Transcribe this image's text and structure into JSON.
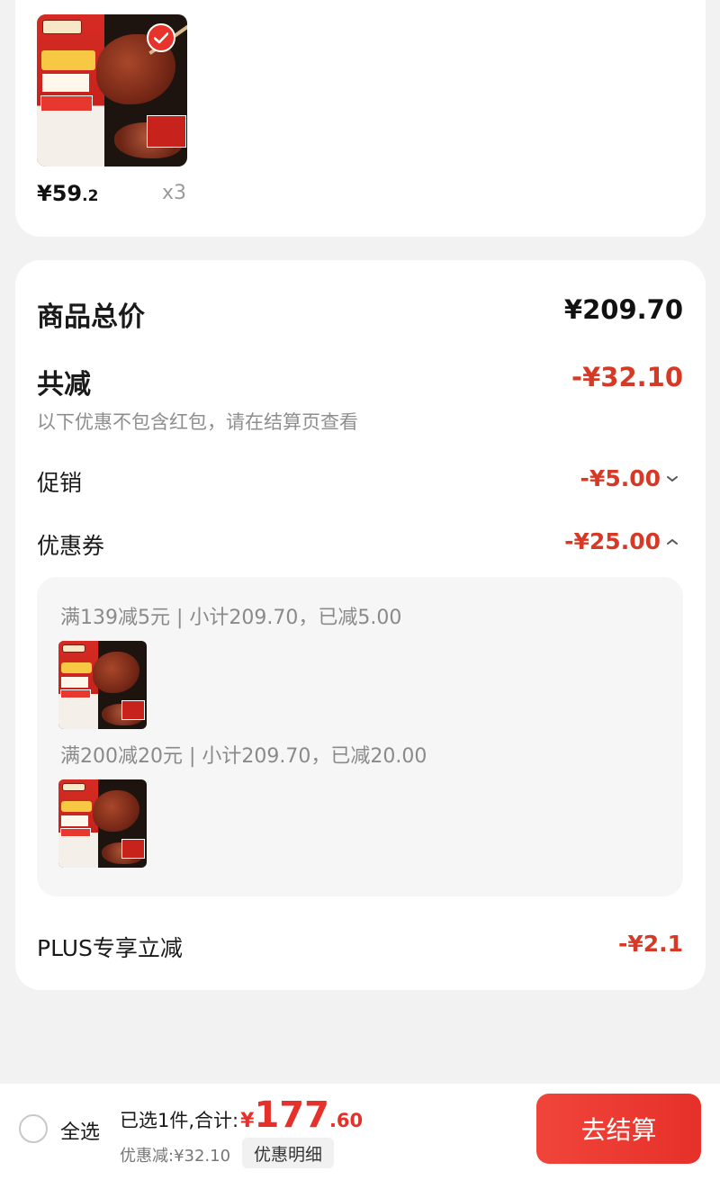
{
  "product": {
    "price_main": "¥59",
    "price_decimal": ".2",
    "quantity": "x3",
    "image_icon": "braised-beef-product-image",
    "selected_icon": "checkmark-icon"
  },
  "summary": {
    "total_label": "商品总价",
    "total_value": "¥209.70",
    "discount_label": "共减",
    "discount_value": "-¥32.10",
    "discount_note": "以下优惠不包含红包，请在结算页查看",
    "promo_label": "促销",
    "promo_value": "-¥5.00",
    "coupon_label": "优惠券",
    "coupon_value": "-¥25.00",
    "coupon_rules": [
      {
        "text": "满139减5元 | 小计209.70，已减5.00"
      },
      {
        "text": "满200减20元 | 小计209.70，已减20.00"
      }
    ],
    "plus_label": "PLUS专享立减",
    "plus_value": "-¥2.1"
  },
  "bottom_bar": {
    "select_all_label": "全选",
    "selected_summary": "已选1件,合计:",
    "currency": "¥",
    "total_int": "177",
    "total_decimal": ".60",
    "discount_text": "优惠减:¥32.10",
    "detail_button": "优惠明细",
    "checkout_button": "去结算"
  },
  "colors": {
    "accent_red": "#e6302a",
    "discount_red": "#d63a26",
    "background": "#f2f2f2"
  }
}
